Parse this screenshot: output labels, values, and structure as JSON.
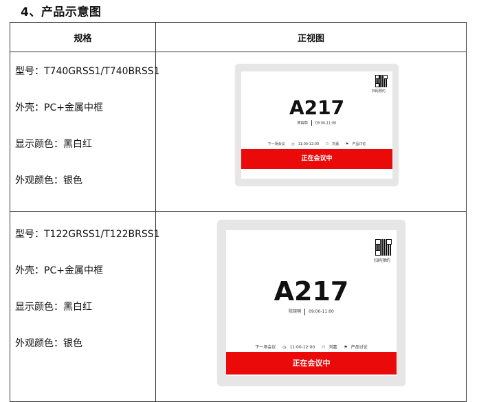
{
  "heading": "4、产品示意图",
  "table": {
    "headers": [
      "规格",
      "正视图"
    ],
    "rows": [
      {
        "specs": [
          "型号：T740GRSS1/T740BRSS1",
          "外壳：PC+金属中框",
          "显示颜色：黑白红",
          "外观颜色：银色"
        ],
        "device": {
          "room": "A217",
          "person": "陈晓明",
          "time": "09:00-11:00",
          "qr_label": "扫码预约",
          "next_label": "下一场会议",
          "next_time": "11:00-12:00",
          "next_person": "刘嘉",
          "next_topic": "产品讨论",
          "status": "正在会议中"
        }
      },
      {
        "specs": [
          "型号：T122GRSS1/T122BRSS1",
          "外壳：PC+金属中框",
          "显示颜色：黑白红",
          "外观颜色：银色"
        ],
        "device": {
          "room": "A217",
          "person": "陈晓明",
          "time": "09:00-11:00",
          "qr_label": "扫码预约",
          "next_label": "下一场会议",
          "next_time": "11:00-12:00",
          "next_person": "刘嘉",
          "next_topic": "产品讨论",
          "status": "正在会议中"
        }
      }
    ]
  },
  "colors": {
    "banner": "#ea0a0a",
    "frame": "#e6e6e6"
  },
  "icons": [
    "clock-icon",
    "user-add-icon",
    "flag-icon",
    "qr-code-icon"
  ]
}
